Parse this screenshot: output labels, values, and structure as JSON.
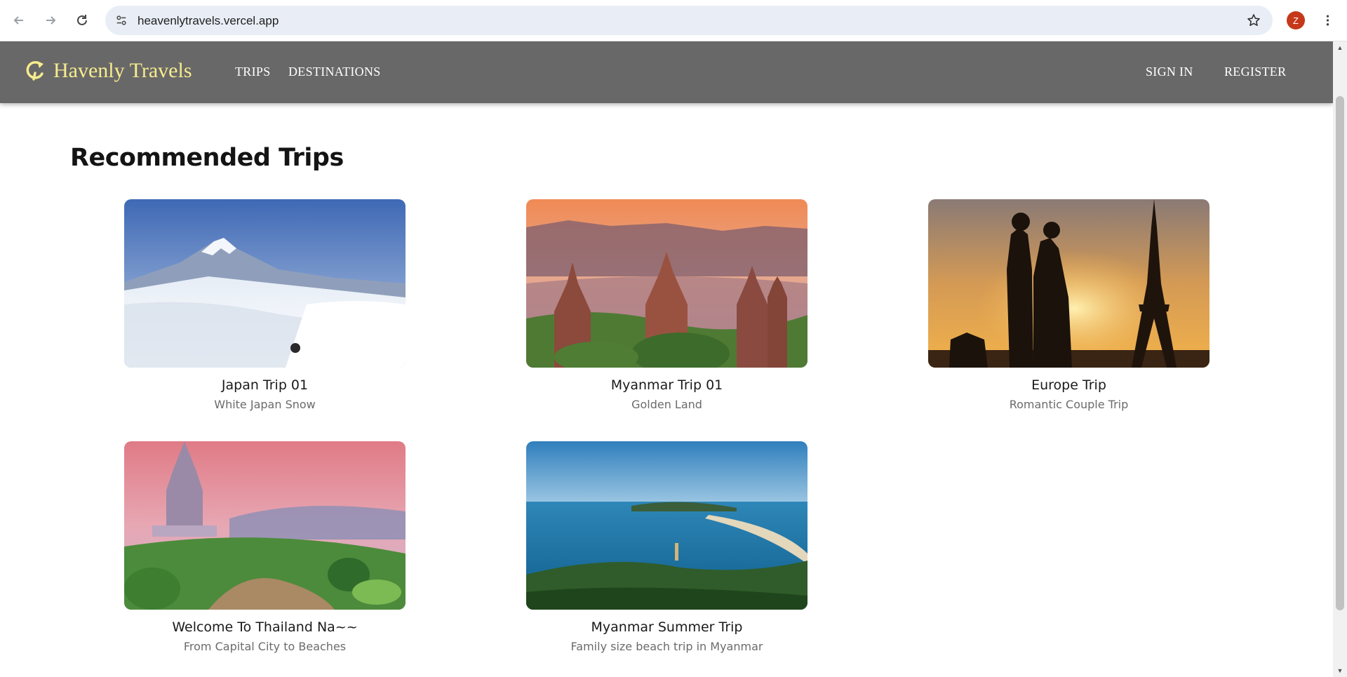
{
  "browser": {
    "url": "heavenlytravels.vercel.app",
    "profile_initial": "Z",
    "profile_color": "#c5381a"
  },
  "app": {
    "brand": "Havenly Travels",
    "brand_color": "#f7ec8e",
    "navbar_color": "#686868",
    "nav_left": [
      "TRIPS",
      "DESTINATIONS"
    ],
    "nav_right": [
      "SIGN IN",
      "REGISTER"
    ]
  },
  "main": {
    "heading": "Recommended Trips",
    "trips": [
      {
        "title": "Japan Trip 01",
        "subtitle": "White Japan Snow",
        "image": "snowy-mountain-photo"
      },
      {
        "title": "Myanmar Trip 01",
        "subtitle": "Golden Land",
        "image": "bagan-pagodas-photo"
      },
      {
        "title": "Europe Trip",
        "subtitle": "Romantic Couple Trip",
        "image": "eiffel-tower-sunset-photo"
      },
      {
        "title": "Welcome To Thailand Na~~",
        "subtitle": "From Capital City to Beaches",
        "image": "thai-pagoda-garden-photo"
      },
      {
        "title": "Myanmar Summer Trip",
        "subtitle": "Family size beach trip in Myanmar",
        "image": "tropical-bay-photo"
      }
    ]
  }
}
